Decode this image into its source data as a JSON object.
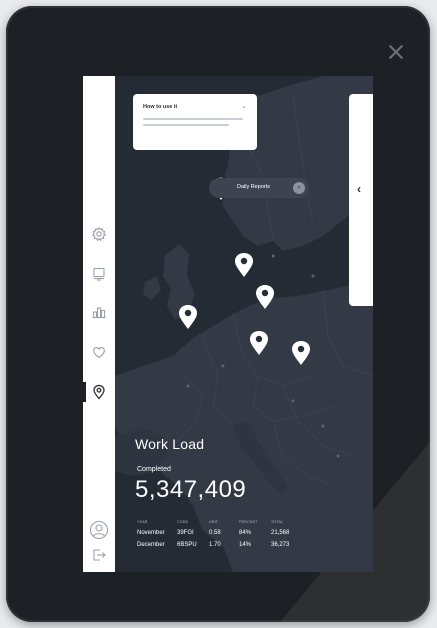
{
  "help_card": {
    "title": "How to use it",
    "chevron": "⌄"
  },
  "daily_reports": {
    "label": "Daily Reports",
    "go_icon": "arrow-right-icon"
  },
  "sidebar": {
    "items": [
      "settings-icon",
      "monitor-icon",
      "chart-icon",
      "heart-icon",
      "location-icon"
    ],
    "active": "location-icon",
    "bottom": [
      "profile-icon",
      "logout-icon"
    ]
  },
  "panel": {
    "arrow": "‹"
  },
  "workload": {
    "title": "Work Load",
    "subtitle": "Completed",
    "value": "5,347,409",
    "headers": [
      "YEAR",
      "CODE",
      "UNIT",
      "PERCENT",
      "TOTAL"
    ],
    "rows": [
      [
        "November",
        "39FGI",
        "0.58",
        "84%",
        "21,568"
      ],
      [
        "December",
        "6BSPU",
        "1.70",
        "14%",
        "36,273"
      ]
    ]
  },
  "colors": {
    "accent": "#ffffff",
    "sidebar_bg": "#ffffff",
    "map_bg": "#272d36",
    "land": "#353c47"
  }
}
